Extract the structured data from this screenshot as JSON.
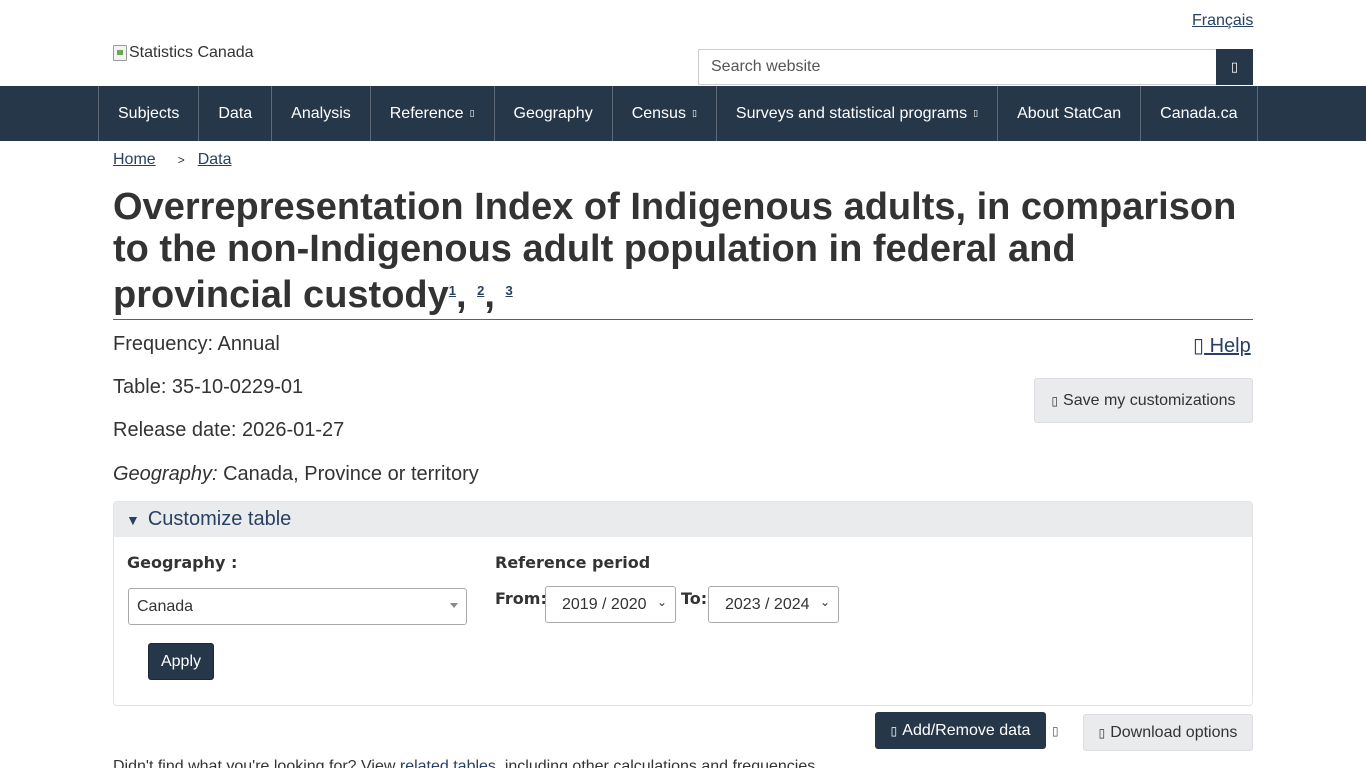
{
  "header": {
    "language_link": "Français",
    "brand_alt": "Statistics Canada",
    "search_placeholder": "Search website",
    "search_icon": "search-icon"
  },
  "nav": {
    "items": [
      {
        "label": "Subjects",
        "caret": ""
      },
      {
        "label": "Data",
        "caret": ""
      },
      {
        "label": "Analysis",
        "caret": ""
      },
      {
        "label": "Reference",
        "caret": "▯"
      },
      {
        "label": "Geography",
        "caret": ""
      },
      {
        "label": "Census",
        "caret": "▯"
      },
      {
        "label": "Surveys and statistical programs",
        "caret": "▯"
      },
      {
        "label": "About StatCan",
        "caret": ""
      },
      {
        "label": "Canada.ca",
        "caret": ""
      }
    ]
  },
  "breadcrumb": {
    "home": "Home",
    "separator": ">",
    "data": "Data"
  },
  "page": {
    "title": "Overrepresentation Index of Indigenous adults, in comparison to the non-Indigenous adult population in federal and provincial custody",
    "footnotes": [
      "1",
      "2",
      "3"
    ],
    "comma": ","
  },
  "meta": {
    "frequency": "Frequency: Annual",
    "table": "Table: 35-10-0229-01",
    "release_date": "Release date: 2026-01-27",
    "geography_label": "Geography:",
    "geography_value": " Canada, Province or territory"
  },
  "actions": {
    "help_label": " Help",
    "help_icon": "▯",
    "save_label": "Save my customizations",
    "save_icon": "▯"
  },
  "customize": {
    "summary": "Customize table",
    "geography_label": "Geography :",
    "geography_value": "Canada",
    "reference_period_label": "Reference period",
    "from_label": "From:",
    "from_value": "2019 / 2020",
    "to_label": "To:",
    "to_value": "2023 / 2024",
    "apply_label": "Apply"
  },
  "toolbar": {
    "add_remove_label": "Add/Remove data",
    "add_remove_icon": "▯",
    "small_icon": "▯",
    "download_label": "Download options",
    "download_icon": "▯"
  },
  "bottom": {
    "text_before": "Didn't find what you're looking for? View ",
    "related_link": "related tables",
    "text_after": ", including other calculations and frequencies."
  },
  "colors": {
    "nav_bg": "#26374a",
    "link": "#284162",
    "title_rule": "#af3c43",
    "button_grey": "#eaebed"
  }
}
